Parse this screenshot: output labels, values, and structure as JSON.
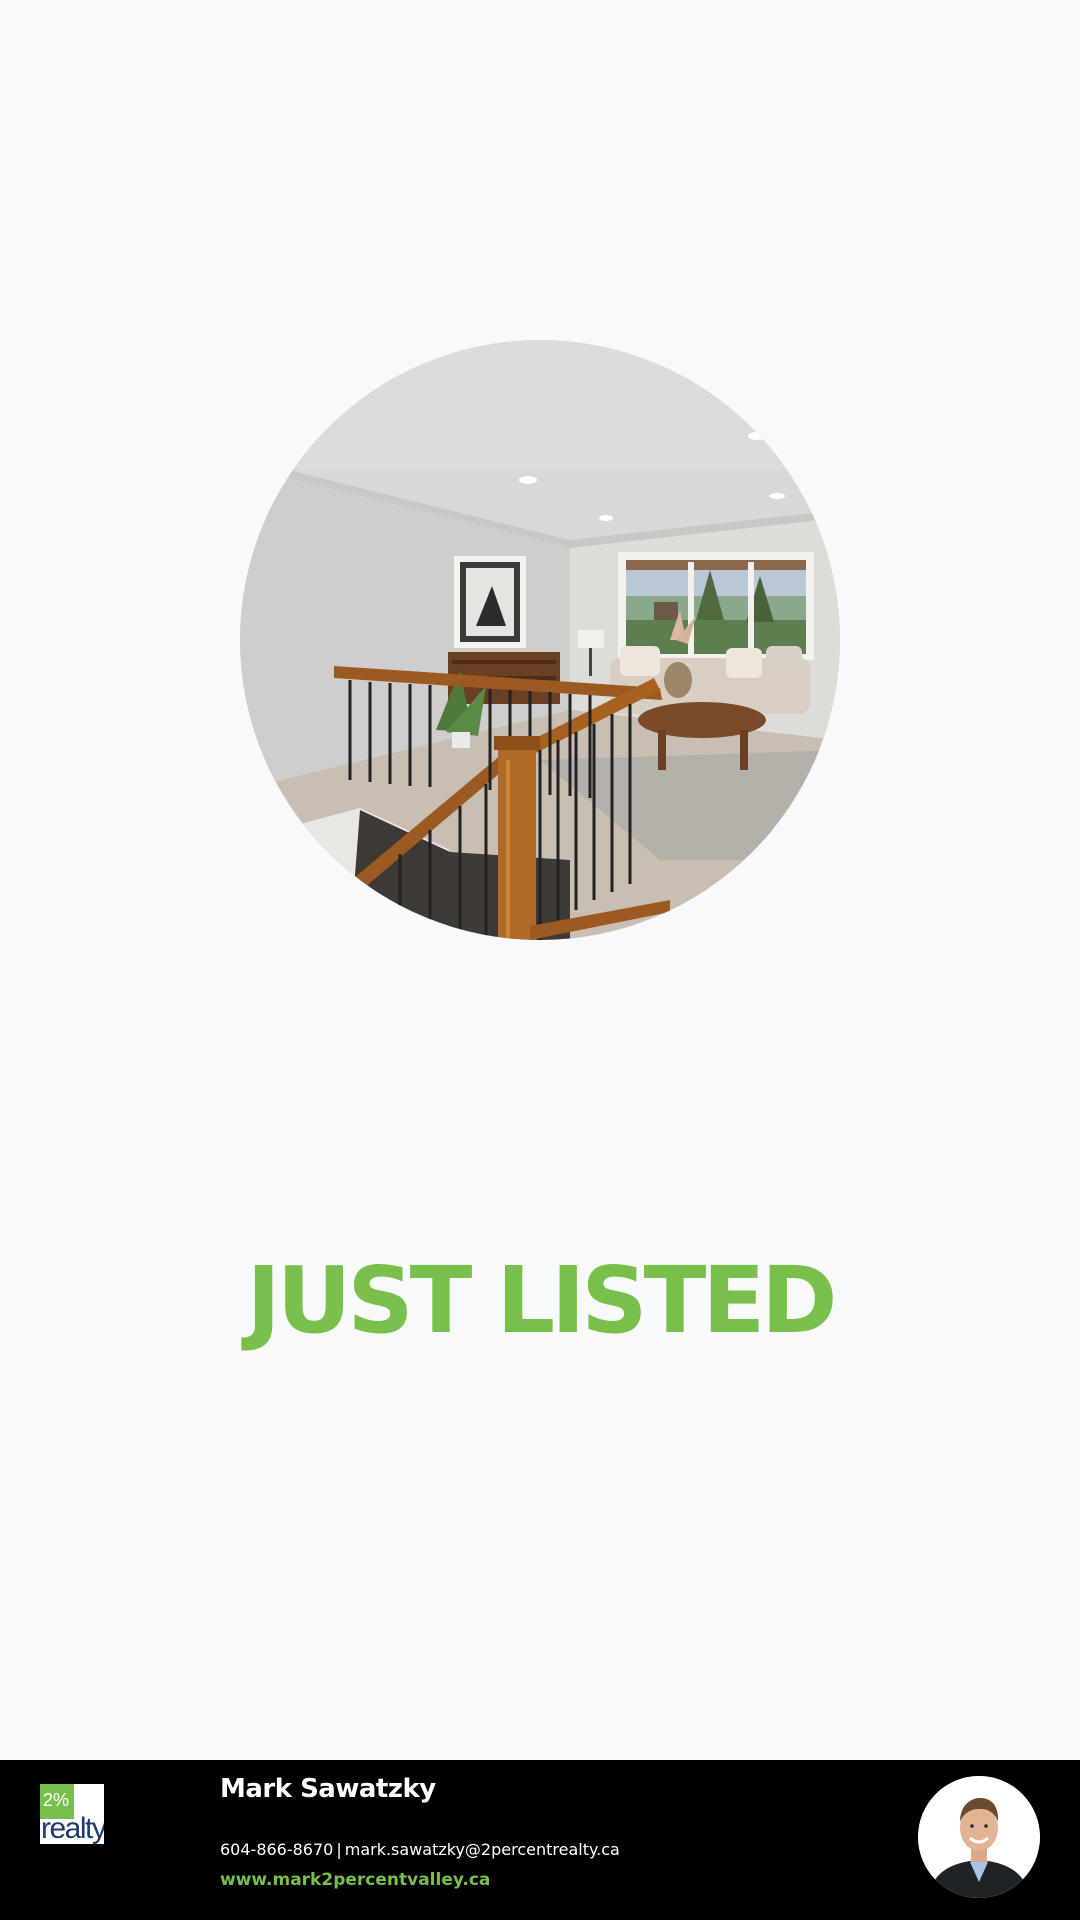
{
  "headline": {
    "text": "JUST LISTED",
    "color": "#79bf4b"
  },
  "photo": {
    "description_icon": "listing-photo"
  },
  "agent": {
    "name": "Mark Sawatzky",
    "phone": "604-866-8670",
    "separator": "|",
    "email": "mark.sawatzky@2percentrealty.ca",
    "website": "www.mark2percentvalley.ca"
  },
  "brand": {
    "logo_percent": "2%",
    "logo_word": "realty",
    "accent_color": "#79bf4b",
    "navy_color": "#1d3a72"
  },
  "footer": {
    "background": "#000000"
  }
}
